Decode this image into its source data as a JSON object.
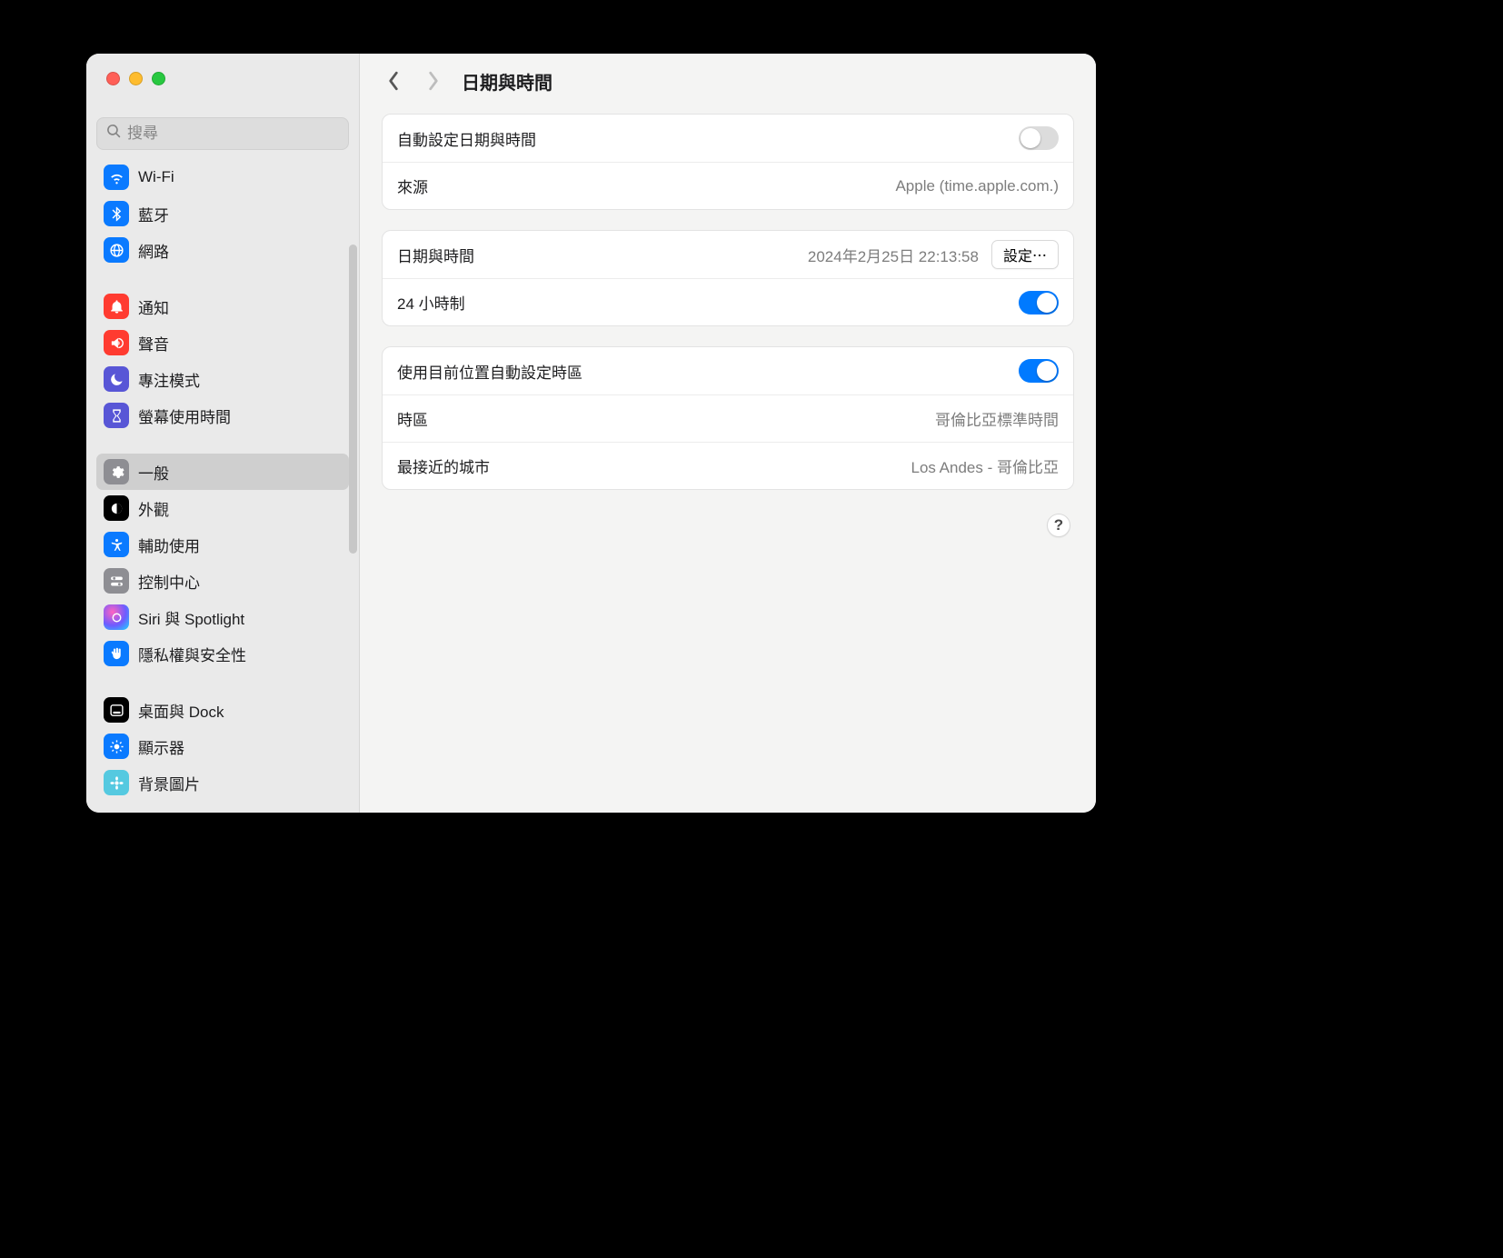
{
  "search": {
    "placeholder": "搜尋"
  },
  "sidebar": {
    "items": [
      {
        "id": "wifi",
        "label": "Wi-Fi",
        "color": "#0a7aff"
      },
      {
        "id": "bluetooth",
        "label": "藍牙",
        "color": "#0a7aff"
      },
      {
        "id": "network",
        "label": "網路",
        "color": "#0a7aff"
      },
      {
        "id": "notif",
        "label": "通知",
        "color": "#ff3b30"
      },
      {
        "id": "sound",
        "label": "聲音",
        "color": "#ff3b30"
      },
      {
        "id": "focus",
        "label": "專注模式",
        "color": "#5856d6"
      },
      {
        "id": "screen",
        "label": "螢幕使用時間",
        "color": "#5856d6"
      },
      {
        "id": "general",
        "label": "一般",
        "color": "#8e8e93",
        "selected": true
      },
      {
        "id": "appear",
        "label": "外觀",
        "color": "#000000"
      },
      {
        "id": "a11y",
        "label": "輔助使用",
        "color": "#0a7aff"
      },
      {
        "id": "cc",
        "label": "控制中心",
        "color": "#8e8e93"
      },
      {
        "id": "siri",
        "label": "Siri 與 Spotlight",
        "color": "#000000"
      },
      {
        "id": "privacy",
        "label": "隱私權與安全性",
        "color": "#0a7aff"
      },
      {
        "id": "dock",
        "label": "桌面與 Dock",
        "color": "#000000"
      },
      {
        "id": "display",
        "label": "顯示器",
        "color": "#0a7aff"
      },
      {
        "id": "wall",
        "label": "背景圖片",
        "color": "#34c8d3"
      }
    ]
  },
  "header": {
    "title": "日期與時間"
  },
  "rows": {
    "auto_datetime": {
      "label": "自動設定日期與時間",
      "on": false
    },
    "source": {
      "label": "來源",
      "value": "Apple (time.apple.com.)"
    },
    "datetime": {
      "label": "日期與時間",
      "value": "2024年2月25日 22:13:58",
      "button": "設定⋯"
    },
    "twentyfour": {
      "label": "24 小時制",
      "on": true
    },
    "auto_tz": {
      "label": "使用目前位置自動設定時區",
      "on": true
    },
    "tz": {
      "label": "時區",
      "value": "哥倫比亞標準時間"
    },
    "city": {
      "label": "最接近的城市",
      "value": "Los Andes - 哥倫比亞"
    }
  },
  "help": "?"
}
